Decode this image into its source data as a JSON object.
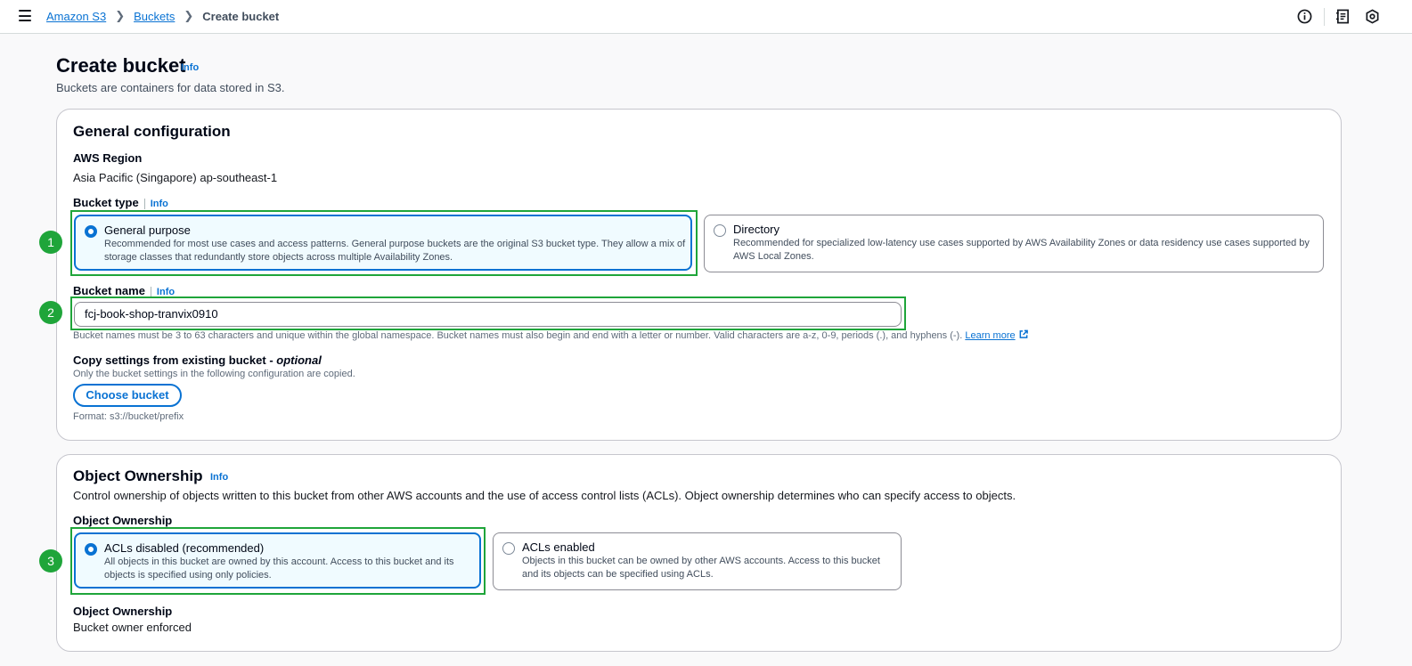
{
  "breadcrumbs": {
    "root": "Amazon S3",
    "parent": "Buckets",
    "current": "Create bucket"
  },
  "header": {
    "title": "Create bucket",
    "info": "Info",
    "description": "Buckets are containers for data stored in S3."
  },
  "general": {
    "title": "General configuration",
    "region_label": "AWS Region",
    "region_value": "Asia Pacific (Singapore) ap-southeast-1",
    "bucket_type_label": "Bucket type",
    "bucket_type_info": "Info",
    "types": [
      {
        "title": "General purpose",
        "desc1": "Recommended for most use cases and access patterns. General purpose buckets are the original S3 bucket type. They allow a mix of",
        "desc2": "storage classes that redundantly store objects across multiple Availability Zones."
      },
      {
        "title": "Directory",
        "desc1": "Recommended for specialized low-latency use cases supported by AWS Availability Zones or data residency use cases supported by",
        "desc2": "AWS Local Zones."
      }
    ],
    "bucket_name_label": "Bucket name",
    "bucket_name_info": "Info",
    "bucket_name_value": "fcj-book-shop-tranvix0910",
    "bucket_name_hint": "Bucket names must be 3 to 63 characters and unique within the global namespace. Bucket names must also begin and end with a letter or number. Valid characters are a-z, 0-9, periods (.), and hyphens (-).",
    "learn_more": "Learn more",
    "copy_label": "Copy settings from existing bucket - ",
    "copy_optional": "optional",
    "copy_hint": "Only the bucket settings in the following configuration are copied.",
    "choose_bucket": "Choose bucket",
    "format_hint": "Format: s3://bucket/prefix"
  },
  "ownership": {
    "title": "Object Ownership",
    "info": "Info",
    "description": "Control ownership of objects written to this bucket from other AWS accounts and the use of access control lists (ACLs). Object ownership determines who can specify access to objects.",
    "label": "Object Ownership",
    "options": [
      {
        "title": "ACLs disabled (recommended)",
        "desc1": "All objects in this bucket are owned by this account. Access to this bucket and its",
        "desc2": "objects is specified using only policies."
      },
      {
        "title": "ACLs enabled",
        "desc1": "Objects in this bucket can be owned by other AWS accounts. Access to this bucket",
        "desc2": "and its objects can be specified using ACLs."
      }
    ],
    "result_label": "Object Ownership",
    "result_value": "Bucket owner enforced"
  },
  "annotations": [
    "1",
    "2",
    "3"
  ],
  "colors": {
    "accent": "#0972d3",
    "highlight": "#1fa53a"
  }
}
